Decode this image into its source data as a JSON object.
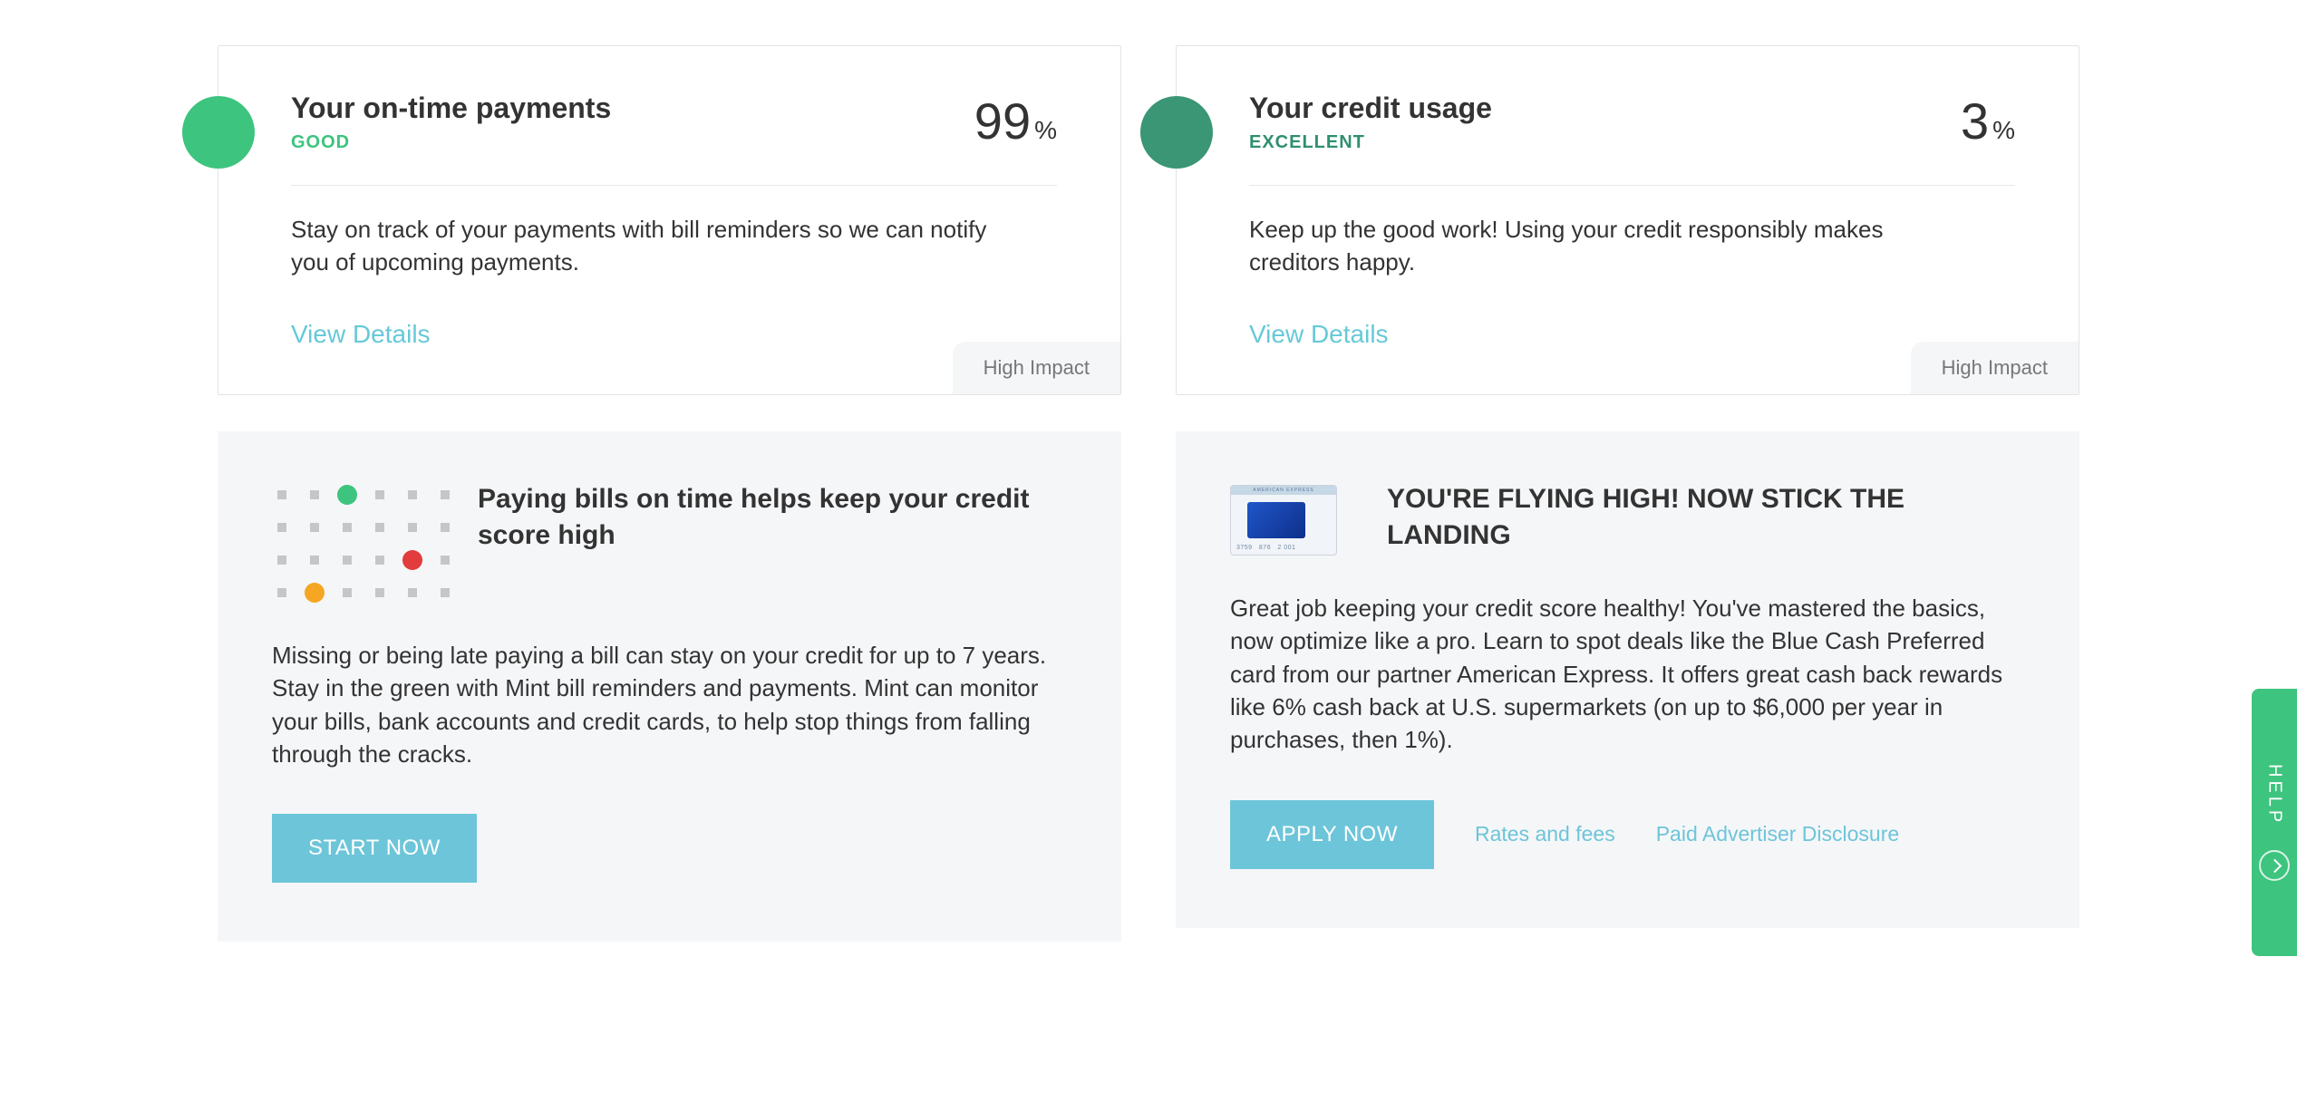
{
  "cards": {
    "payments": {
      "title": "Your on-time payments",
      "rating": "GOOD",
      "value": "99",
      "pct": "%",
      "desc": "Stay on track of your payments with bill reminders so we can notify you of upcoming payments.",
      "view_details": "View Details",
      "impact": "High Impact"
    },
    "usage": {
      "title": "Your credit usage",
      "rating": "EXCELLENT",
      "value": "3",
      "pct": "%",
      "desc": "Keep up the good work! Using your credit responsibly makes creditors happy.",
      "view_details": "View Details",
      "impact": "High Impact"
    }
  },
  "promos": {
    "bills": {
      "title": "Paying bills on time helps keep your credit score high",
      "desc": "Missing or being late paying a bill can stay on your credit for up to 7 years. Stay in the green with Mint bill reminders and payments. Mint can monitor your bills, bank accounts and credit cards, to help stop things from falling through the cracks.",
      "cta": "START NOW"
    },
    "card_offer": {
      "title": "YOU'RE FLYING HIGH! NOW STICK THE LANDING",
      "desc": "Great job keeping your credit score healthy! You've mastered the basics, now optimize like a pro. Learn to spot deals like the Blue Cash Preferred card from our partner American Express. It offers great cash back rewards like 6% cash back at U.S. supermarkets (on up to $6,000 per year in purchases, then 1%).",
      "cta": "APPLY NOW",
      "link_rates": "Rates and fees",
      "link_disclosure": "Paid Advertiser Disclosure"
    }
  },
  "help": {
    "label": "HELP"
  }
}
